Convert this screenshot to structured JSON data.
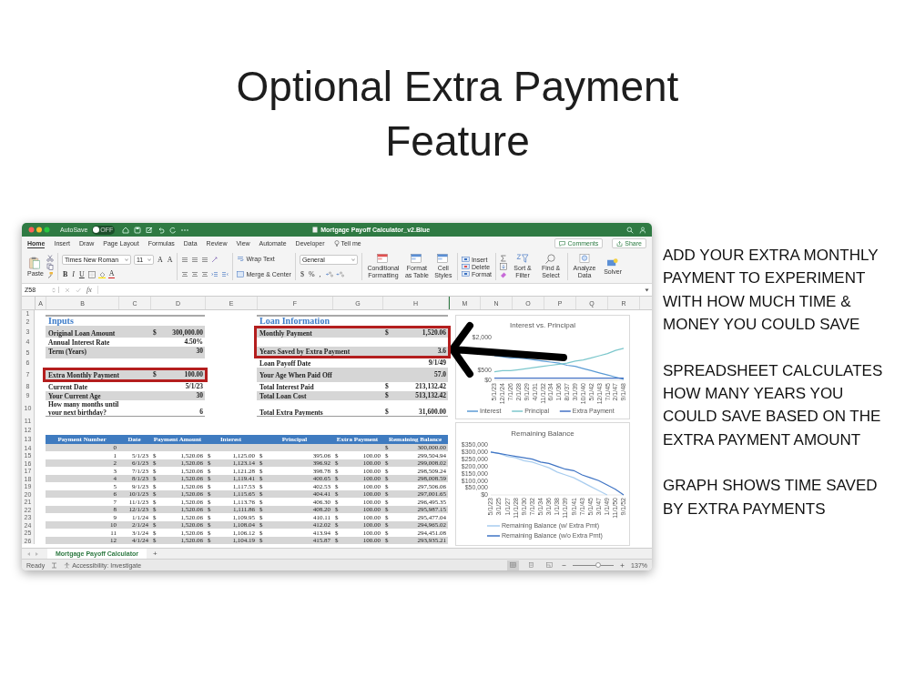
{
  "title": "Optional Extra Payment Feature",
  "window": {
    "title": "Mortgage Payoff Calculator_v2.Blue",
    "autosave": {
      "label": "AutoSave",
      "on": false,
      "state": "OFF"
    }
  },
  "menu_tabs": [
    {
      "label": "Home",
      "selected": true
    },
    {
      "label": "Insert",
      "selected": false
    },
    {
      "label": "Draw",
      "selected": false
    },
    {
      "label": "Page Layout",
      "selected": false
    },
    {
      "label": "Formulas",
      "selected": false
    },
    {
      "label": "Data",
      "selected": false
    },
    {
      "label": "Review",
      "selected": false
    },
    {
      "label": "View",
      "selected": false
    },
    {
      "label": "Automate",
      "selected": false
    },
    {
      "label": "Developer",
      "selected": false
    }
  ],
  "tell_me": "Tell me",
  "comments": "Comments",
  "share": "Share",
  "ribbon": {
    "paste": "Paste",
    "font_name": "Times New Roman",
    "font_size": "11",
    "grow_font": "A",
    "shrink_font": "A",
    "styles": [
      "B",
      "I",
      "U"
    ],
    "font_color": "A",
    "wrap_text": "Wrap Text",
    "merge": "Merge & Center",
    "number_format": "General",
    "currency": "$",
    "percent": "%",
    "comma": ",",
    "style_buttons": [
      "Conditional Formatting",
      "Format as Table",
      "Cell Styles"
    ],
    "cell_buttons": [
      "Insert",
      "Delete",
      "Format"
    ],
    "edit_buttons": [
      "Sort & Filter",
      "Find & Select"
    ],
    "analyze": "Analyze Data",
    "solver": "Solver"
  },
  "formula_bar": {
    "name_box": "Z58",
    "fx": "fx"
  },
  "columns": [
    "A",
    "B",
    "C",
    "D",
    "E",
    "F",
    "G",
    "H",
    "M",
    "N",
    "O",
    "P",
    "Q",
    "R"
  ],
  "summary": [
    {
      "row": "1"
    },
    {
      "row": "2",
      "left": {
        "kind": "heading",
        "label": "Inputs"
      },
      "right": {
        "kind": "heading",
        "label": "Loan Information"
      }
    },
    {
      "row": "3",
      "left": {
        "kind": "field",
        "label": "Original Loan Amount",
        "sign": "$",
        "value": "300,000.00",
        "highlighted": false
      },
      "right": {
        "kind": "field",
        "label": "Monthly Payment",
        "sign": "$",
        "value": "1,520.06",
        "highlighted": true
      }
    },
    {
      "row": "4",
      "left": {
        "kind": "field",
        "label": "Annual Interest Rate",
        "value": "4.50%",
        "highlighted": false
      }
    },
    {
      "row": "5",
      "left": {
        "kind": "field",
        "label": "Term (Years)",
        "value": "30",
        "highlighted": false
      },
      "right": {
        "kind": "field",
        "label": "Years Saved by Extra Payment",
        "value": "3.6",
        "highlighted": true
      }
    },
    {
      "row": "6",
      "right": {
        "kind": "field",
        "label": "Loan Payoff Date",
        "value": "9/1/49",
        "highlighted": false
      }
    },
    {
      "row": "7",
      "left": {
        "kind": "field",
        "label": "Extra Monthly Payment",
        "sign": "$",
        "value": "100.00",
        "highlighted": true
      },
      "right": {
        "kind": "field",
        "label": "Your Age When Paid Off",
        "value": "57.0",
        "highlighted": false
      }
    },
    {
      "row": "8",
      "left": {
        "kind": "field",
        "label": "Current Date",
        "value": "5/1/23",
        "highlighted": false
      },
      "right": {
        "kind": "field",
        "label": "Total Interest Paid",
        "sign": "$",
        "value": "213,132.42",
        "highlighted": false
      }
    },
    {
      "row": "9",
      "left": {
        "kind": "field",
        "label": "Your Current Age",
        "value": "30",
        "highlighted": false
      },
      "right": {
        "kind": "field",
        "label": "Total Loan Cost",
        "sign": "$",
        "value": "513,132.42",
        "highlighted": false
      }
    },
    {
      "row": "10",
      "left": {
        "kind": "field",
        "label": "How many months until your next birthday?",
        "value": "6",
        "highlighted": false
      },
      "right": {
        "kind": "field",
        "label": "Total Extra Payments",
        "sign": "$",
        "value": "31,600.00",
        "highlighted": false
      }
    },
    {
      "row": "11"
    },
    {
      "row": "12"
    }
  ],
  "table": {
    "header_row": "13",
    "columns": [
      "Payment Number",
      "Date",
      "Payment Amount",
      "Interest",
      "Principal",
      "Extra Payment",
      "Remaining Balance"
    ],
    "rows": [
      {
        "row": "14",
        "number": "0",
        "balance": {
          "sign": "$",
          "amount": "300,000.00"
        }
      },
      {
        "row": "15",
        "number": "1",
        "date": "5/1/23",
        "payment": {
          "sign": "$",
          "amount": "1,520.06"
        },
        "interest": {
          "sign": "$",
          "amount": "1,125.00"
        },
        "principal": {
          "sign": "$",
          "amount": "395.06"
        },
        "extra": {
          "sign": "$",
          "amount": "100.00"
        },
        "balance": {
          "sign": "$",
          "amount": "299,504.94"
        }
      },
      {
        "row": "16",
        "number": "2",
        "date": "6/1/23",
        "payment": {
          "sign": "$",
          "amount": "1,520.06"
        },
        "interest": {
          "sign": "$",
          "amount": "1,123.14"
        },
        "principal": {
          "sign": "$",
          "amount": "396.92"
        },
        "extra": {
          "sign": "$",
          "amount": "100.00"
        },
        "balance": {
          "sign": "$",
          "amount": "299,008.02"
        }
      },
      {
        "row": "17",
        "number": "3",
        "date": "7/1/23",
        "payment": {
          "sign": "$",
          "amount": "1,520.06"
        },
        "interest": {
          "sign": "$",
          "amount": "1,121.28"
        },
        "principal": {
          "sign": "$",
          "amount": "398.78"
        },
        "extra": {
          "sign": "$",
          "amount": "100.00"
        },
        "balance": {
          "sign": "$",
          "amount": "298,509.24"
        }
      },
      {
        "row": "18",
        "number": "4",
        "date": "8/1/23",
        "payment": {
          "sign": "$",
          "amount": "1,520.06"
        },
        "interest": {
          "sign": "$",
          "amount": "1,119.41"
        },
        "principal": {
          "sign": "$",
          "amount": "400.65"
        },
        "extra": {
          "sign": "$",
          "amount": "100.00"
        },
        "balance": {
          "sign": "$",
          "amount": "298,008.59"
        }
      },
      {
        "row": "19",
        "number": "5",
        "date": "9/1/23",
        "payment": {
          "sign": "$",
          "amount": "1,520.06"
        },
        "interest": {
          "sign": "$",
          "amount": "1,117.53"
        },
        "principal": {
          "sign": "$",
          "amount": "402.53"
        },
        "extra": {
          "sign": "$",
          "amount": "100.00"
        },
        "balance": {
          "sign": "$",
          "amount": "297,506.06"
        }
      },
      {
        "row": "20",
        "number": "6",
        "date": "10/1/23",
        "payment": {
          "sign": "$",
          "amount": "1,520.06"
        },
        "interest": {
          "sign": "$",
          "amount": "1,115.65"
        },
        "principal": {
          "sign": "$",
          "amount": "404.41"
        },
        "extra": {
          "sign": "$",
          "amount": "100.00"
        },
        "balance": {
          "sign": "$",
          "amount": "297,001.65"
        }
      },
      {
        "row": "21",
        "number": "7",
        "date": "11/1/23",
        "payment": {
          "sign": "$",
          "amount": "1,520.06"
        },
        "interest": {
          "sign": "$",
          "amount": "1,113.76"
        },
        "principal": {
          "sign": "$",
          "amount": "406.30"
        },
        "extra": {
          "sign": "$",
          "amount": "100.00"
        },
        "balance": {
          "sign": "$",
          "amount": "296,495.35"
        }
      },
      {
        "row": "22",
        "number": "8",
        "date": "12/1/23",
        "payment": {
          "sign": "$",
          "amount": "1,520.06"
        },
        "interest": {
          "sign": "$",
          "amount": "1,111.86"
        },
        "principal": {
          "sign": "$",
          "amount": "408.20"
        },
        "extra": {
          "sign": "$",
          "amount": "100.00"
        },
        "balance": {
          "sign": "$",
          "amount": "295,987.15"
        }
      },
      {
        "row": "23",
        "number": "9",
        "date": "1/1/24",
        "payment": {
          "sign": "$",
          "amount": "1,520.06"
        },
        "interest": {
          "sign": "$",
          "amount": "1,109.95"
        },
        "principal": {
          "sign": "$",
          "amount": "410.11"
        },
        "extra": {
          "sign": "$",
          "amount": "100.00"
        },
        "balance": {
          "sign": "$",
          "amount": "295,477.04"
        }
      },
      {
        "row": "24",
        "number": "10",
        "date": "2/1/24",
        "payment": {
          "sign": "$",
          "amount": "1,520.06"
        },
        "interest": {
          "sign": "$",
          "amount": "1,108.04"
        },
        "principal": {
          "sign": "$",
          "amount": "412.02"
        },
        "extra": {
          "sign": "$",
          "amount": "100.00"
        },
        "balance": {
          "sign": "$",
          "amount": "294,965.02"
        }
      },
      {
        "row": "25",
        "number": "11",
        "date": "3/1/24",
        "payment": {
          "sign": "$",
          "amount": "1,520.06"
        },
        "interest": {
          "sign": "$",
          "amount": "1,106.12"
        },
        "principal": {
          "sign": "$",
          "amount": "413.94"
        },
        "extra": {
          "sign": "$",
          "amount": "100.00"
        },
        "balance": {
          "sign": "$",
          "amount": "294,451.08"
        }
      },
      {
        "row": "26",
        "number": "12",
        "date": "4/1/24",
        "payment": {
          "sign": "$",
          "amount": "1,520.06"
        },
        "interest": {
          "sign": "$",
          "amount": "1,104.19"
        },
        "principal": {
          "sign": "$",
          "amount": "415.87"
        },
        "extra": {
          "sign": "$",
          "amount": "100.00"
        },
        "balance": {
          "sign": "$",
          "amount": "293,935.21"
        }
      }
    ]
  },
  "charts": [
    {
      "chart_data": {
        "type": "line",
        "title": "Interest vs. Principal",
        "categories": [
          "5/1/23",
          "12/1/24",
          "7/1/26",
          "2/1/28",
          "9/1/29",
          "4/1/31",
          "11/1/32",
          "6/1/34",
          "1/1/36",
          "8/1/37",
          "3/1/39",
          "10/1/40",
          "5/1/42",
          "12/1/43",
          "7/1/45",
          "2/1/47",
          "9/1/48"
        ],
        "series": [
          {
            "name": "Interest",
            "color": "#5b9bd5",
            "values": [
              1150,
              1100,
              1050,
              1050,
              1000,
              950,
              900,
              850,
              800,
              700,
              650,
              550,
              450,
              350,
              250,
              150,
              50
            ]
          },
          {
            "name": "Principal",
            "color": "#7cc7cc",
            "values": [
              400,
              450,
              450,
              500,
              550,
              600,
              650,
              700,
              750,
              800,
              900,
              950,
              1050,
              1150,
              1250,
              1400,
              1500
            ]
          },
          {
            "name": "Extra Payment",
            "color": "#4472c4",
            "values": [
              100,
              100,
              100,
              100,
              100,
              100,
              100,
              100,
              100,
              100,
              100,
              100,
              100,
              100,
              100,
              100,
              100
            ]
          }
        ],
        "legend": "bottom",
        "ylim": [
          0,
          2000
        ],
        "yticks": [
          {
            "value": 0,
            "label": "$0"
          },
          {
            "value": 500,
            "label": "$500"
          },
          {
            "value": 2000,
            "label": "$2,000"
          }
        ]
      }
    },
    {
      "chart_data": {
        "type": "line",
        "title": "Remaining Balance",
        "categories": [
          "5/1/23",
          "3/1/25",
          "1/1/27",
          "11/1/28",
          "9/1/30",
          "7/1/32",
          "5/1/34",
          "3/1/36",
          "1/1/38",
          "11/1/39",
          "9/1/41",
          "7/1/43",
          "5/1/45",
          "3/1/47",
          "1/1/49",
          "11/1/50",
          "9/1/52"
        ],
        "series": [
          {
            "name": "Remaining Balance (w/ Extra Pmt)",
            "color": "#a9cdef",
            "values": [
              300000,
              290000,
              270000,
              260000,
              240000,
              230000,
              210000,
              190000,
              160000,
              140000,
              120000,
              90000,
              60000,
              30000,
              0,
              null,
              null
            ]
          },
          {
            "name": "Remaining Balance (w/o Extra Pmt)",
            "color": "#3f74c4",
            "values": [
              300000,
              290000,
              280000,
              270000,
              260000,
              250000,
              230000,
              220000,
              200000,
              180000,
              170000,
              140000,
              120000,
              100000,
              70000,
              40000,
              0
            ]
          }
        ],
        "legend": "bottom",
        "ylim": [
          0,
          350000
        ],
        "yticks": [
          {
            "value": 0,
            "label": "$0"
          },
          {
            "value": 50000,
            "label": "$50,000"
          },
          {
            "value": 100000,
            "label": "$100,000"
          },
          {
            "value": 150000,
            "label": "$150,000"
          },
          {
            "value": 200000,
            "label": "$200,000"
          },
          {
            "value": 250000,
            "label": "$250,000"
          },
          {
            "value": 300000,
            "label": "$300,000"
          },
          {
            "value": 350000,
            "label": "$350,000"
          }
        ]
      }
    }
  ],
  "sheet_tabs": [
    {
      "label": "Mortgage Payoff Calculator",
      "selected": true
    }
  ],
  "add_sheet": "+",
  "status_bar": {
    "ready": "Ready",
    "accessibility": "Accessibility: Investigate",
    "views": [
      {
        "kind": "normal",
        "selected": true
      },
      {
        "kind": "page-layout",
        "selected": false
      },
      {
        "kind": "page-break",
        "selected": false
      }
    ],
    "zoom": {
      "level": 0.62,
      "reading": "137%"
    }
  },
  "notes": [
    "ADD YOUR EXTRA MONTHLY PAYMENT TO EXPERIMENT WITH HOW MUCH TIME & MONEY YOU COULD SAVE",
    "SPREADSHEET CALCULATES HOW MANY YEARS YOU COULD SAVE BASED ON THE EXTRA PAYMENT AMOUNT",
    "GRAPH SHOWS TIME SAVED BY EXTRA PAYMENTS"
  ]
}
